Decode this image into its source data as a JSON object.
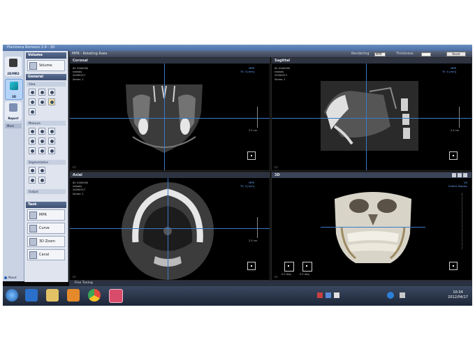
{
  "window": {
    "title": "Planmeca Romexis 2.9 - 3D"
  },
  "left_nav": {
    "items": [
      {
        "label": "2D/MR2",
        "icon": "xray-2d-icon"
      },
      {
        "label": "3D",
        "icon": "cube-3d-icon"
      },
      {
        "label": "Report",
        "icon": "report-icon"
      }
    ],
    "more_label": "More",
    "about_label": "About"
  },
  "tool_panel": {
    "volume_header": "Volume",
    "volume_button": "Volume",
    "general_header": "General",
    "view_label": "View",
    "measure_label": "Measure",
    "segmentation_label": "Segmentation",
    "output_label": "Output",
    "task_header": "Task",
    "tasks": [
      {
        "label": "MPR",
        "icon": "mpr-icon"
      },
      {
        "label": "Curve",
        "icon": "curve-icon"
      },
      {
        "label": "3D Zoom",
        "icon": "zoom-3d-icon"
      },
      {
        "label": "Canal",
        "icon": "canal-icon"
      }
    ]
  },
  "main": {
    "title": "MPR - Rotating Axes",
    "rendering_label": "Rendering",
    "rendering_value": "MPR",
    "thickness_label": "Thickness",
    "thickness_value": "",
    "reset_label": "Reset"
  },
  "viewports": {
    "coronal": {
      "title": "Coronal",
      "info": "ID: 0000000\nnobody\n20090317\nSeries: 1",
      "mode": "MPR",
      "thickness": "Th: 0 [mm]",
      "scale": "2.5 cm",
      "modality": "CT"
    },
    "sagittal": {
      "title": "Sagittal",
      "info": "ID: 0000000\nnobody\n20090317\nSeries: 1",
      "mode": "MPR",
      "thickness": "Th: 0 [mm]",
      "scale": "2.5 cm",
      "modality": "CT"
    },
    "axial": {
      "title": "Axial",
      "info": "ID: 0000000\nnobody\n20090317\nSeries: 1",
      "mode": "MPR",
      "thickness": "Th: 0 [mm]",
      "scale": "2.5 cm",
      "modality": "CT"
    },
    "volume3d": {
      "title": "3D",
      "mode": "VR",
      "preset": "Outline Display",
      "modality": "CT",
      "rot1": "0.0 deg",
      "rot2": "0.0 deg"
    }
  },
  "fine_tuning_label": "Fine Tuning",
  "taskbar": {
    "time": "10:34",
    "date": "2012/04/17",
    "icons": [
      "start-orb-icon",
      "ie-browser-icon",
      "folder-icon",
      "media-player-icon",
      "chrome-icon",
      "romexis-icon"
    ]
  }
}
